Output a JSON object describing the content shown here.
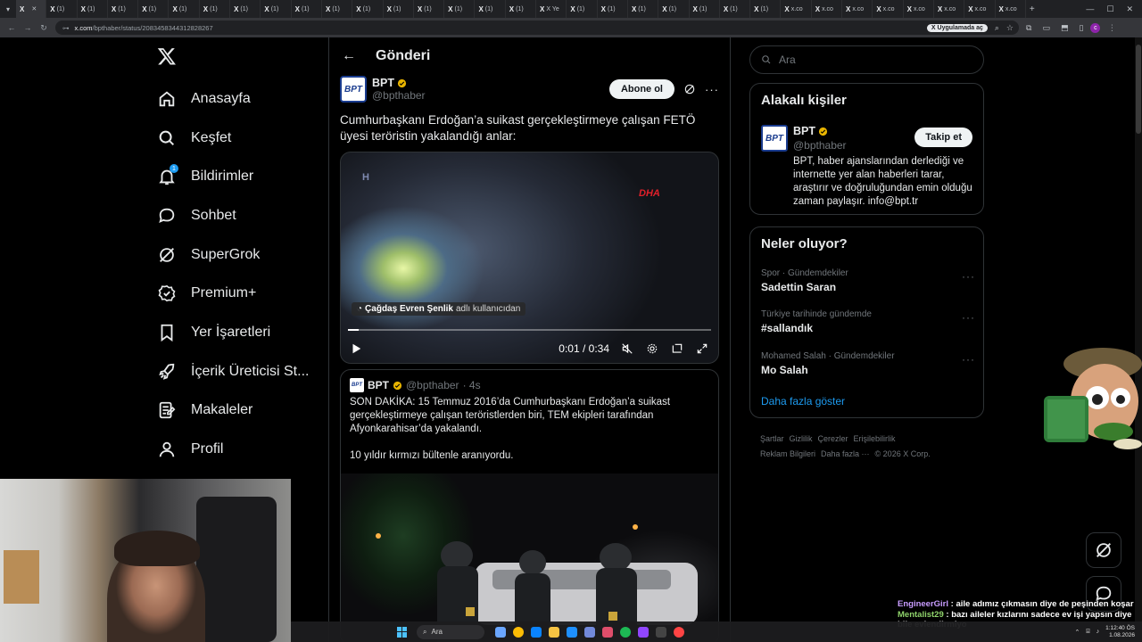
{
  "browser": {
    "tabs": [
      {
        "label": "",
        "icon": "x-icon"
      },
      {
        "label": "(1) ",
        "icon": "x-icon"
      },
      {
        "label": "(1) ",
        "icon": "x-icon"
      },
      {
        "label": "(1) ",
        "icon": "x-icon"
      },
      {
        "label": "(1) ",
        "icon": "x-icon"
      },
      {
        "label": "(1) ",
        "icon": "x-icon"
      },
      {
        "label": "(1) ",
        "icon": "x-icon"
      },
      {
        "label": "(1) ",
        "icon": "x-icon"
      },
      {
        "label": "(1) ",
        "icon": "x-icon"
      },
      {
        "label": "(1) ",
        "icon": "x-icon"
      },
      {
        "label": "(1) ",
        "icon": "x-icon"
      },
      {
        "label": "(1) ",
        "icon": "x-icon"
      },
      {
        "label": "(1) ",
        "icon": "x-icon"
      },
      {
        "label": "(1) ",
        "icon": "x-icon"
      },
      {
        "label": "(1) ",
        "icon": "x-icon"
      },
      {
        "label": "(1) ",
        "icon": "x-icon"
      },
      {
        "label": "(1) ",
        "icon": "x-icon"
      },
      {
        "label": "X Ye",
        "icon": "x-icon"
      },
      {
        "label": "(1) ",
        "icon": "x-icon"
      },
      {
        "label": "(1) ",
        "icon": "x-icon"
      },
      {
        "label": "(1) ",
        "icon": "x-icon"
      },
      {
        "label": "(1) ",
        "icon": "x-icon"
      },
      {
        "label": "(1) ",
        "icon": "x-icon"
      },
      {
        "label": "(1) ",
        "icon": "x-icon"
      },
      {
        "label": "(1) ",
        "icon": "x-icon"
      },
      {
        "label": "x.co",
        "icon": "x-icon"
      },
      {
        "label": "x.co",
        "icon": "x-icon"
      },
      {
        "label": "x.co",
        "icon": "x-icon"
      },
      {
        "label": "x.co",
        "icon": "x-icon"
      },
      {
        "label": "x.co",
        "icon": "x-icon"
      },
      {
        "label": "x.co",
        "icon": "x-icon"
      },
      {
        "label": "x.co",
        "icon": "x-icon"
      },
      {
        "label": "x.co",
        "icon": "x-icon"
      }
    ],
    "url_host": "x.com",
    "url_path": "/bpthaber/status/2083458344312828267",
    "profile_chip": "Uygulamada aç",
    "profile_initial": "c"
  },
  "nav": {
    "items": [
      {
        "label": "Anasayfa",
        "icon": "home-icon"
      },
      {
        "label": "Keşfet",
        "icon": "search-icon"
      },
      {
        "label": "Bildirimler",
        "icon": "bell-icon",
        "badge": "1"
      },
      {
        "label": "Sohbet",
        "icon": "chat-icon"
      },
      {
        "label": "SuperGrok",
        "icon": "grok-icon"
      },
      {
        "label": "Premium+",
        "icon": "premium-icon"
      },
      {
        "label": "Yer İşaretleri",
        "icon": "bookmark-icon"
      },
      {
        "label": "İçerik Üreticisi St...",
        "icon": "rocket-icon"
      },
      {
        "label": "Makaleler",
        "icon": "article-icon"
      },
      {
        "label": "Profil",
        "icon": "profile-icon"
      }
    ]
  },
  "post": {
    "page_title": "Gönderi",
    "author_name": "BPT",
    "author_handle": "@bpthaber",
    "logo_text": "BPT",
    "subscribe_label": "Abone ol",
    "more": "···",
    "text": "Cumhurbaşkanı Erdoğan’a suikast gerçekleştirmeye çalışan FETÖ üyesi teröristin yakalandığı anlar:",
    "video": {
      "watermark": "DHA",
      "corner_mark": "H",
      "credit_name": "Çağdaş Evren Şenlik",
      "credit_suffix": "adlı kullanıcıdan",
      "time": "0:01 / 0:34",
      "progress": 0.03
    },
    "quote": {
      "name": "BPT",
      "handle": "@bpthaber",
      "age": "· 4s",
      "text": "SON DAKİKA: 15 Temmuz 2016’da Cumhurbaşkanı Erdoğan’a suikast gerçekleştirmeye çalışan teröristlerden biri, TEM ekipleri tarafından Afyonkarahisar’da yakalandı.\n\n10 yıldır kırmızı bültenle aranıyordu."
    }
  },
  "right": {
    "search_placeholder": "Ara",
    "related": {
      "title": "Alakalı kişiler",
      "name": "BPT",
      "handle": "@bpthaber",
      "follow_label": "Takip et",
      "bio": "BPT, haber ajanslarından derlediği ve internette yer alan haberleri tarar, araştırır ve doğruluğundan emin olduğu zaman paylaşır. info@bpt.tr"
    },
    "trending": {
      "title": "Neler oluyor?",
      "items": [
        {
          "context": "Spor · Gündemdekiler",
          "title": "Sadettin Saran"
        },
        {
          "context": "Türkiye tarihinde gündemde",
          "title": "#sallandık"
        },
        {
          "context": "Mohamed Salah · Gündemdekiler",
          "title": "Mo Salah"
        }
      ],
      "show_more": "Daha fazla göster"
    },
    "footer": [
      "Şartlar",
      "Gizlilik",
      "Çerezler",
      "Erişilebilirlik",
      "Reklam Bilgileri",
      "Daha fazla ···",
      "© 2026 X Corp."
    ]
  },
  "chat": [
    {
      "user": "EngineerGirl",
      "text": ": aile adımız çıkmasın diye de peşinden koşar"
    },
    {
      "user": "Mentalist29",
      "text": ": bazı aileler kızlarını sadece ev işi yapsın diye bile evlendirmiyo"
    }
  ],
  "taskbar": {
    "search_placeholder": "Ara",
    "time": "1:12:40 ÖS",
    "date": "1.08.2026"
  },
  "colors": {
    "accent": "#1d9bf0",
    "background": "#000000",
    "border": "#2f3336",
    "muted_text": "#71767b"
  }
}
